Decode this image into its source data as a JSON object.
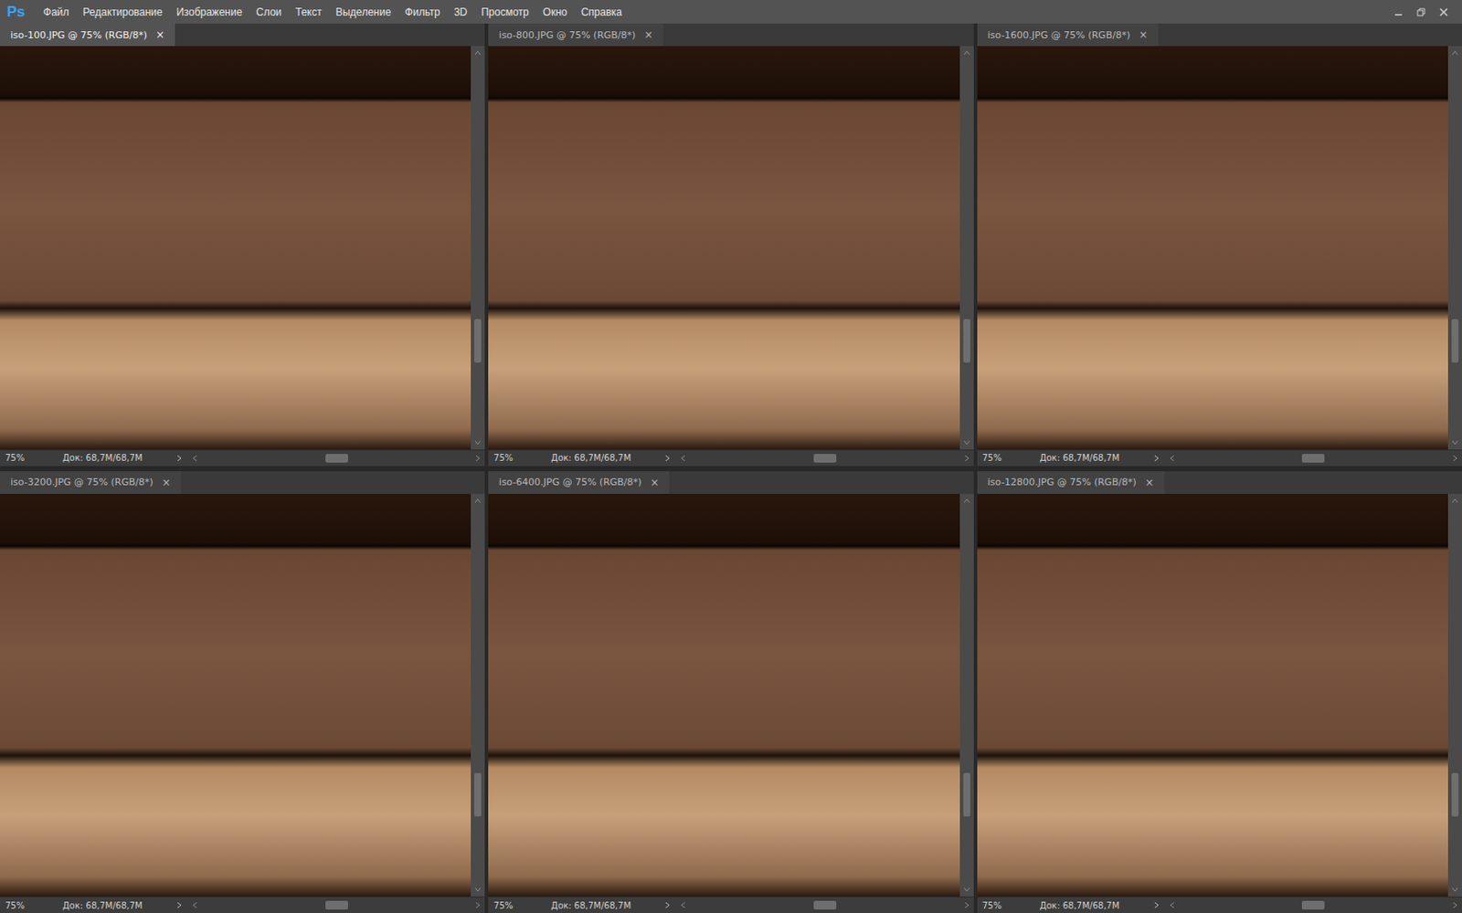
{
  "app": {
    "logo": "Ps",
    "menu": [
      "Файл",
      "Редактирование",
      "Изображение",
      "Слои",
      "Текст",
      "Выделение",
      "Фильтр",
      "3D",
      "Просмотр",
      "Окно",
      "Справка"
    ]
  },
  "documents": [
    {
      "title": "iso-100.JPG @ 75% (RGB/8*)",
      "selected": true,
      "close": "×",
      "zoom": "75%",
      "doc_size": "Док: 68,7M/68,7M",
      "v_scroll": 0.78,
      "h_scroll": 0.5
    },
    {
      "title": "iso-800.JPG @ 75% (RGB/8*)",
      "selected": false,
      "close": "×",
      "zoom": "75%",
      "doc_size": "Док: 68,7M/68,7M",
      "v_scroll": 0.78,
      "h_scroll": 0.5
    },
    {
      "title": "iso-1600.JPG @ 75% (RGB/8*)",
      "selected": false,
      "close": "×",
      "zoom": "75%",
      "doc_size": "Док: 68,7M/68,7M",
      "v_scroll": 0.78,
      "h_scroll": 0.5
    },
    {
      "title": "iso-3200.JPG @ 75% (RGB/8*)",
      "selected": false,
      "close": "×",
      "zoom": "75%",
      "doc_size": "Док: 68,7M/68,7M",
      "v_scroll": 0.8,
      "h_scroll": 0.5
    },
    {
      "title": "iso-6400.JPG @ 75% (RGB/8*)",
      "selected": false,
      "close": "×",
      "zoom": "75%",
      "doc_size": "Док: 68,7M/68,7M",
      "v_scroll": 0.8,
      "h_scroll": 0.5
    },
    {
      "title": "iso-12800.JPG @ 75% (RGB/8*)",
      "selected": false,
      "close": "×",
      "zoom": "75%",
      "doc_size": "Док: 68,7M/68,7M",
      "v_scroll": 0.8,
      "h_scroll": 0.5
    }
  ]
}
